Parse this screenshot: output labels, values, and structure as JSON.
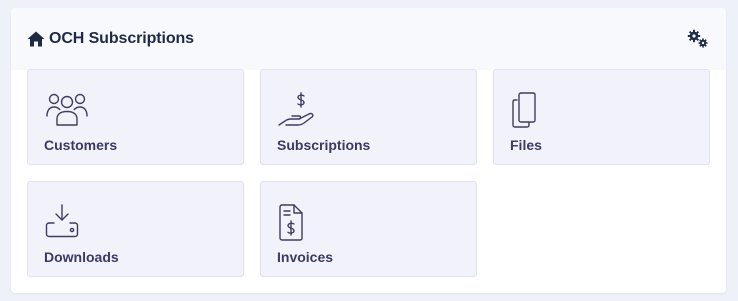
{
  "header": {
    "title": "OCH Subscriptions",
    "home_icon": "home-icon",
    "settings_icon": "gears-icon"
  },
  "tiles": [
    {
      "label": "Customers",
      "icon": "users-icon"
    },
    {
      "label": "Subscriptions",
      "icon": "hand-dollar-icon"
    },
    {
      "label": "Files",
      "icon": "files-icon"
    },
    {
      "label": "Downloads",
      "icon": "download-drive-icon"
    },
    {
      "label": "Invoices",
      "icon": "invoice-icon"
    }
  ],
  "colors": {
    "background": "#eef1f8",
    "header_bg": "#f8f9fd",
    "tile_bg": "#f2f2fb",
    "tile_border": "#e1e2ee",
    "title_text": "#1f2a44",
    "tile_text": "#3a3a63",
    "icon_stroke": "#3d3d63"
  }
}
